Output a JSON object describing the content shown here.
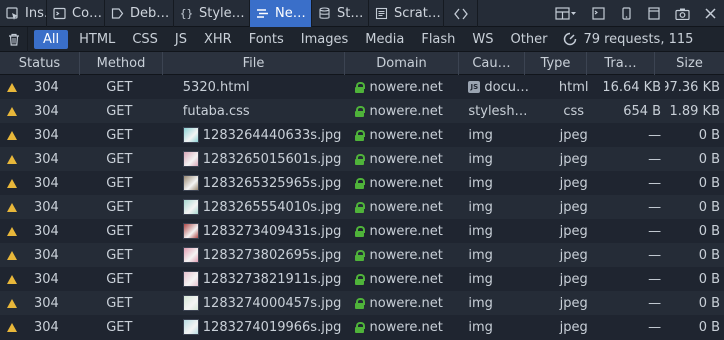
{
  "toolbar": {
    "tabs": [
      {
        "label": "Ins…",
        "icon": "inspector-icon",
        "active": false
      },
      {
        "label": "Co…",
        "icon": "console-icon",
        "active": false
      },
      {
        "label": "Deb…",
        "icon": "debugger-icon",
        "active": false
      },
      {
        "label": "Style…",
        "icon": "style-editor-icon",
        "active": false
      },
      {
        "label": "Ne…",
        "icon": "network-icon",
        "active": true
      },
      {
        "label": "St…",
        "icon": "storage-icon",
        "active": false
      },
      {
        "label": "Scrat…",
        "icon": "scratchpad-icon",
        "active": false
      }
    ],
    "right_icons": [
      "code-icon",
      "dock-layout-icon",
      "split-console-icon",
      "responsive-mode-icon",
      "options-icon",
      "screenshot-icon",
      "close-icon"
    ]
  },
  "filters": {
    "items": [
      "All",
      "HTML",
      "CSS",
      "JS",
      "XHR",
      "Fonts",
      "Images",
      "Media",
      "Flash",
      "WS",
      "Other"
    ],
    "active": "All",
    "summary": "79 requests, 115"
  },
  "table": {
    "headers": {
      "status": "Status",
      "method": "Method",
      "file": "File",
      "domain": "Domain",
      "cause": "Cau…",
      "type": "Type",
      "transferred": "Tra…",
      "size": "Size"
    },
    "rows": [
      {
        "status": "304",
        "method": "GET",
        "file": "5320.html",
        "thumb": null,
        "domain": "nowere.net",
        "cause": "docu…",
        "cause_js": true,
        "type": "html",
        "transferred": "16.64 KB",
        "size": "97.36 KB"
      },
      {
        "status": "304",
        "method": "GET",
        "file": "futaba.css",
        "thumb": null,
        "domain": "nowere.net",
        "cause": "stylesh…",
        "cause_js": false,
        "type": "css",
        "transferred": "654 B",
        "size": "1.89 KB"
      },
      {
        "status": "304",
        "method": "GET",
        "file": "1283264440633s.jpg",
        "thumb": "#8fd3d6",
        "domain": "nowere.net",
        "cause": "img",
        "cause_js": false,
        "type": "jpeg",
        "transferred": "—",
        "size": "0 B"
      },
      {
        "status": "304",
        "method": "GET",
        "file": "1283265015601s.jpg",
        "thumb": "#d9a7b8",
        "domain": "nowere.net",
        "cause": "img",
        "cause_js": false,
        "type": "jpeg",
        "transferred": "—",
        "size": "0 B"
      },
      {
        "status": "304",
        "method": "GET",
        "file": "1283265325965s.jpg",
        "thumb": "#9a8a74",
        "domain": "nowere.net",
        "cause": "img",
        "cause_js": false,
        "type": "jpeg",
        "transferred": "—",
        "size": "0 B"
      },
      {
        "status": "304",
        "method": "GET",
        "file": "1283265554010s.jpg",
        "thumb": "#a8d8d0",
        "domain": "nowere.net",
        "cause": "img",
        "cause_js": false,
        "type": "jpeg",
        "transferred": "—",
        "size": "0 B"
      },
      {
        "status": "304",
        "method": "GET",
        "file": "1283273409431s.jpg",
        "thumb": "#b04a4a",
        "domain": "nowere.net",
        "cause": "img",
        "cause_js": false,
        "type": "jpeg",
        "transferred": "—",
        "size": "0 B"
      },
      {
        "status": "304",
        "method": "GET",
        "file": "1283273802695s.jpg",
        "thumb": "#e2a0b4",
        "domain": "nowere.net",
        "cause": "img",
        "cause_js": false,
        "type": "jpeg",
        "transferred": "—",
        "size": "0 B"
      },
      {
        "status": "304",
        "method": "GET",
        "file": "1283273821911s.jpg",
        "thumb": "#e6c2cf",
        "domain": "nowere.net",
        "cause": "img",
        "cause_js": false,
        "type": "jpeg",
        "transferred": "—",
        "size": "0 B"
      },
      {
        "status": "304",
        "method": "GET",
        "file": "1283274000457s.jpg",
        "thumb": "#d7e7d8",
        "domain": "nowere.net",
        "cause": "img",
        "cause_js": false,
        "type": "jpeg",
        "transferred": "—",
        "size": "0 B"
      },
      {
        "status": "304",
        "method": "GET",
        "file": "1283274019966s.jpg",
        "thumb": "#b9dde3",
        "domain": "nowere.net",
        "cause": "img",
        "cause_js": false,
        "type": "jpeg",
        "transferred": "—",
        "size": "0 B"
      }
    ]
  },
  "colors": {
    "accent": "#3a6fc9",
    "warning": "#e8b73a",
    "secure": "#4fb33a"
  }
}
